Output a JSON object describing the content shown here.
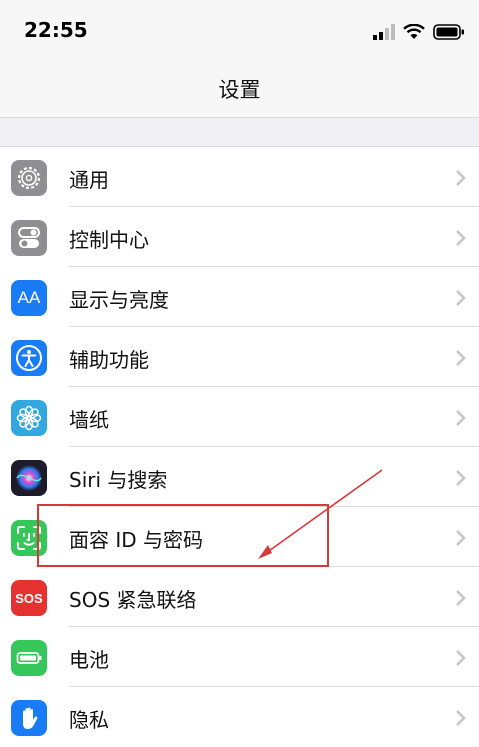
{
  "status_bar": {
    "time": "22:55"
  },
  "nav": {
    "title": "设置"
  },
  "settings": [
    {
      "key": "general",
      "label": "通用",
      "icon": "gear-icon",
      "color": "#8e8e93"
    },
    {
      "key": "control-center",
      "label": "控制中心",
      "icon": "toggle-switches-icon",
      "color": "#8e8e93"
    },
    {
      "key": "display",
      "label": "显示与亮度",
      "icon": "text-size-icon",
      "color": "#1a7cf5",
      "icon_text": "AA"
    },
    {
      "key": "accessibility",
      "label": "辅助功能",
      "icon": "accessibility-icon",
      "color": "#1a7cf5"
    },
    {
      "key": "wallpaper",
      "label": "墙纸",
      "icon": "flower-icon",
      "color": "#33a8e0"
    },
    {
      "key": "siri",
      "label": "Siri 与搜索",
      "icon": "siri-icon",
      "color": "#222"
    },
    {
      "key": "face-id",
      "label": "面容 ID 与密码",
      "icon": "face-id-icon",
      "color": "#35c759"
    },
    {
      "key": "sos",
      "label": "SOS 紧急联络",
      "icon": "sos-icon",
      "color": "#e5312f",
      "icon_text": "SOS"
    },
    {
      "key": "battery",
      "label": "电池",
      "icon": "battery-icon",
      "color": "#35c759"
    },
    {
      "key": "privacy",
      "label": "隐私",
      "icon": "hand-icon",
      "color": "#1a7cf5"
    }
  ],
  "colors": {
    "annotation": "#d8393a",
    "chevron": "#c4c4c7"
  }
}
